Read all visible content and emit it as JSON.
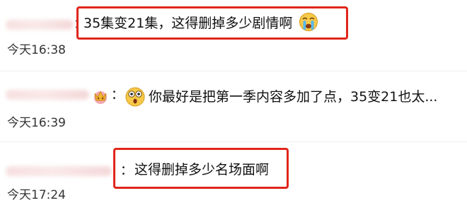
{
  "comments": [
    {
      "text": "35集变21集，这得删掉多少剧情啊",
      "time": "今天16:38",
      "emoji": "crying-face-icon"
    },
    {
      "text": "你最好是把第一季内容多加了点，35变21也太...",
      "time": "今天16:39",
      "emoji": "surprised-face-icon",
      "badge": "crown-badge-icon"
    },
    {
      "text": "这得删掉多少名场面啊",
      "time": "今天17:24"
    }
  ],
  "colon": "：",
  "colors": {
    "highlight": "#e0261b",
    "text": "#111111",
    "time": "#333333",
    "emoji": "#f7c948"
  }
}
